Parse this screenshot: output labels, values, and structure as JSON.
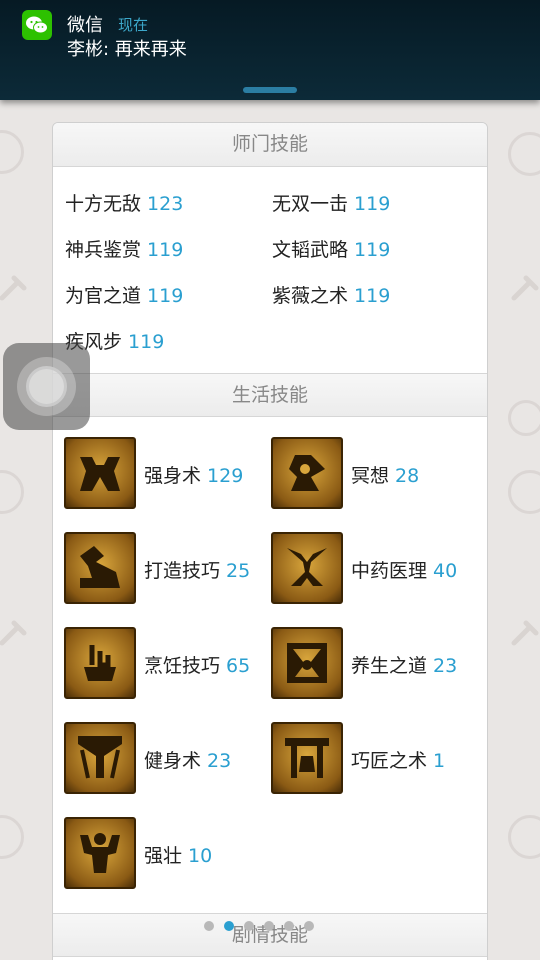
{
  "notification": {
    "app_name": "微信",
    "time": "现在",
    "message": "李彬: 再来再来",
    "icon": "wechat-icon"
  },
  "sections": {
    "master_skills": {
      "title": "师门技能",
      "items": [
        {
          "name": "十方无敌",
          "level": "123"
        },
        {
          "name": "无双一击",
          "level": "119"
        },
        {
          "name": "神兵鉴赏",
          "level": "119"
        },
        {
          "name": "文韬武略",
          "level": "119"
        },
        {
          "name": "为官之道",
          "level": "119"
        },
        {
          "name": "紫薇之术",
          "level": "119"
        },
        {
          "name": "疾风步",
          "level": "119"
        }
      ]
    },
    "life_skills": {
      "title": "生活技能",
      "items": [
        {
          "name": "强身术",
          "level": "129",
          "icon": "strength-icon"
        },
        {
          "name": "冥想",
          "level": "28",
          "icon": "meditation-icon"
        },
        {
          "name": "打造技巧",
          "level": "25",
          "icon": "hammer-icon"
        },
        {
          "name": "中药医理",
          "level": "40",
          "icon": "herb-icon"
        },
        {
          "name": "烹饪技巧",
          "level": "65",
          "icon": "cooking-icon"
        },
        {
          "name": "养生之道",
          "level": "23",
          "icon": "health-icon"
        },
        {
          "name": "健身术",
          "level": "23",
          "icon": "fitness-icon"
        },
        {
          "name": "巧匠之术",
          "level": "1",
          "icon": "craftsman-icon"
        },
        {
          "name": "强壮",
          "level": "10",
          "icon": "muscle-icon"
        }
      ]
    },
    "story_skills": {
      "title": "剧情技能"
    }
  },
  "pager": {
    "count": 6,
    "active": 1
  },
  "colors": {
    "level_text": "#2a9fd0",
    "notification_bg": "#0c2a38",
    "wechat_green": "#2dc100",
    "icon_gold": "#d9a63c"
  }
}
